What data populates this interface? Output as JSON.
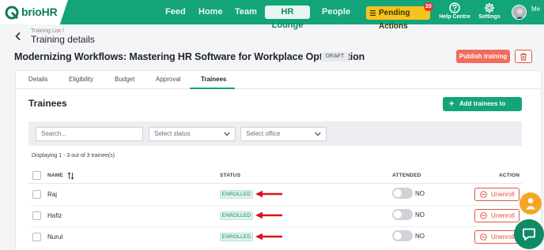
{
  "brand": {
    "name_prefix": "brio",
    "name_suffix": "HR"
  },
  "nav": {
    "items": [
      "Feed",
      "Home",
      "Team",
      "HR Lounge",
      "People"
    ],
    "active": "HR Lounge",
    "pending_label": "Pending Actions",
    "pending_count": "20",
    "help_label": "Help Centre",
    "settings_label": "Settings",
    "user_label": "Me"
  },
  "header": {
    "breadcrumb": "Training List /",
    "page_title": "Training details",
    "training_title": "Modernizing Workflows: Mastering HR Software for Workplace Optimization",
    "status_badge": "DRAFT",
    "publish_label": "Publish training"
  },
  "tabs": [
    "Details",
    "Eligibility",
    "Budget",
    "Approval",
    "Trainees"
  ],
  "active_tab": "Trainees",
  "trainees": {
    "section_title": "Trainees",
    "add_label": "Add trainees to enroll",
    "search_placeholder": "Search...",
    "status_placeholder": "Select status",
    "office_placeholder": "Select office",
    "displaying": "Displaying 1 - 3 out of 3 trainee(s)",
    "columns": {
      "name": "NAME",
      "status": "STATUS",
      "attended": "ATTENDED",
      "action": "ACTION"
    },
    "rows": [
      {
        "name": "Raj",
        "status": "ENROLLED",
        "attended": "NO",
        "action": "Unenroll"
      },
      {
        "name": "Hafiz",
        "status": "ENROLLED",
        "attended": "NO",
        "action": "Unenroll"
      },
      {
        "name": "Nurul",
        "status": "ENROLLED",
        "attended": "NO",
        "action": "Unenroll"
      }
    ]
  },
  "colors": {
    "brand_green": "#14a47a",
    "publish": "#f06c5b",
    "pending": "#f7c31d",
    "arrow": "#d8141c"
  },
  "icons": [
    "brio-logo-icon",
    "lines-icon",
    "help-icon",
    "gear-icon",
    "back-arrow-icon",
    "trash-icon",
    "plus-icon",
    "chevron-down-icon",
    "sort-icon",
    "minus-circle-icon",
    "person-icon",
    "chat-icon",
    "red-arrow-icon"
  ]
}
